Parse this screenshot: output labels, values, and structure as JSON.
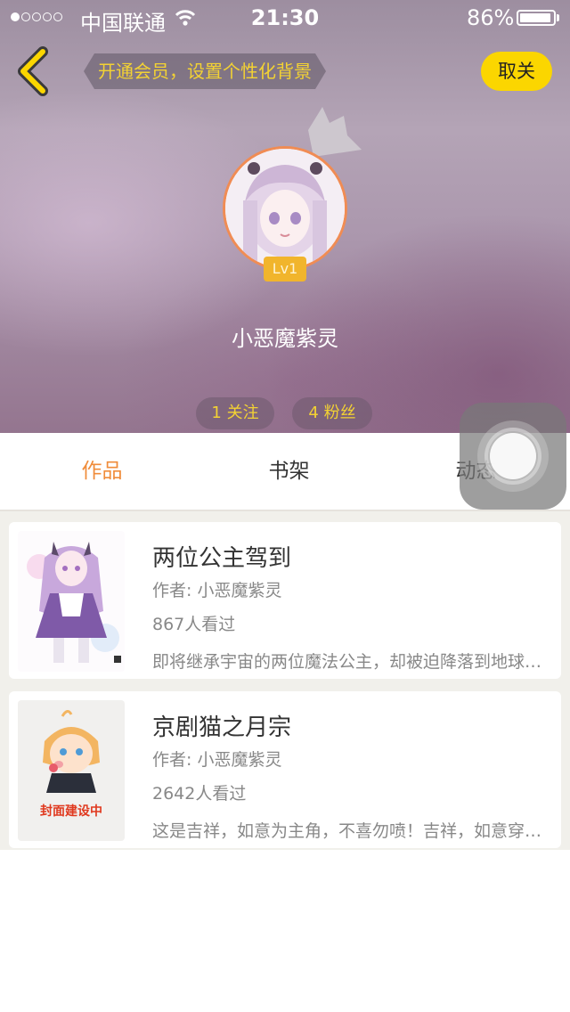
{
  "status_bar": {
    "carrier": "中国联通",
    "time": "21:30",
    "battery": "86%"
  },
  "header": {
    "vip_banner": "开通会员，设置个性化背景",
    "unfollow_label": "取关",
    "level": "Lv1",
    "username": "小恶魔紫灵",
    "follow_count": "1 关注",
    "fans_count": "4 粉丝"
  },
  "tabs": [
    {
      "label": "作品",
      "active": true
    },
    {
      "label": "书架",
      "active": false
    },
    {
      "label": "动态",
      "active": false
    }
  ],
  "works": [
    {
      "title": "两位公主驾到",
      "author": "作者: 小恶魔紫灵",
      "views": "867人看过",
      "description": "即将继承宇宙的两位魔法公主，却被迫降落到地球上学习"
    },
    {
      "title": "京剧猫之月宗",
      "author": "作者: 小恶魔紫灵",
      "views": "2642人看过",
      "description": "这是吉祥，如意为主角，不喜勿喷！吉祥，如意穿越到京剧猫世界"
    }
  ],
  "cover_placeholder": "封面建设中",
  "colors": {
    "accent_orange": "#f08c3a",
    "brand_yellow": "#fbd600",
    "stat_text": "#f3d233"
  }
}
